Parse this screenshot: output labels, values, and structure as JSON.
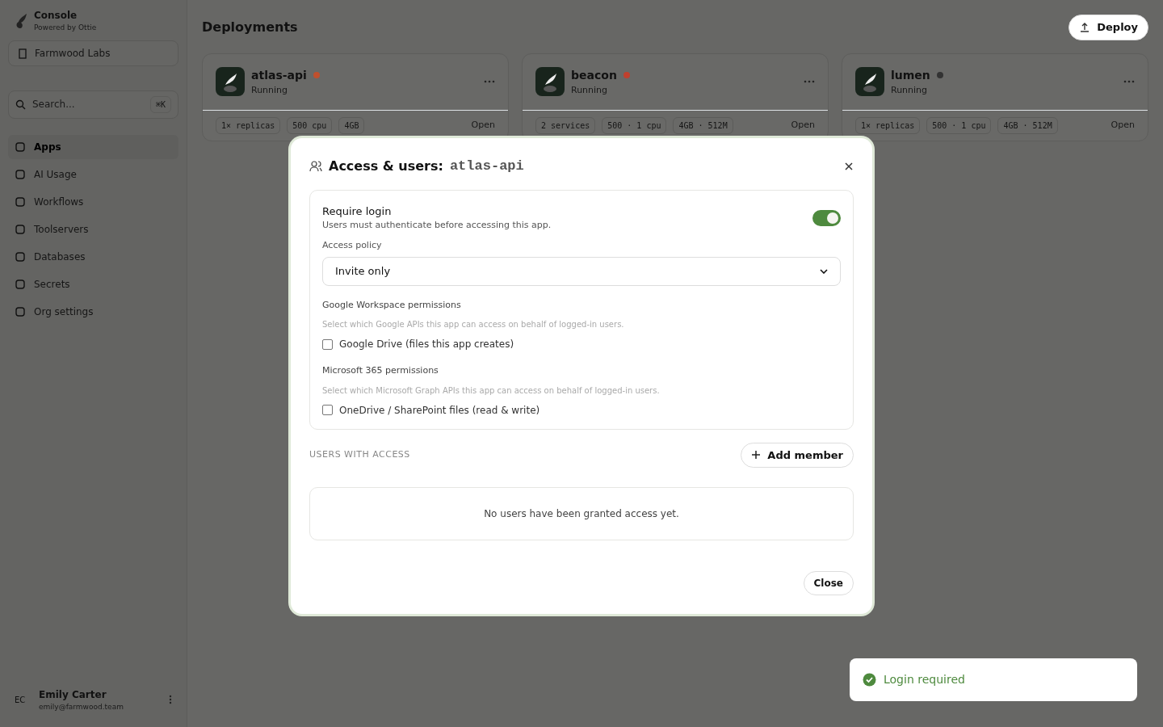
{
  "sidebar": {
    "brand": "Console",
    "brand_sub": "Powered by Ottie",
    "org": "Farmwood Labs",
    "search": {
      "placeholder": "Search...",
      "shortcut": "⌘K"
    },
    "items": [
      {
        "label": "Apps",
        "selected": true
      },
      {
        "label": "AI Usage",
        "selected": false
      },
      {
        "label": "Workflows",
        "selected": false
      },
      {
        "label": "Toolservers",
        "selected": false
      },
      {
        "label": "Databases",
        "selected": false
      },
      {
        "label": "Secrets",
        "selected": false
      },
      {
        "label": "Org settings",
        "selected": false
      }
    ],
    "user": {
      "initials": "EC",
      "name": "Emily Carter",
      "email": "emily@farmwood.team"
    }
  },
  "header": {
    "title": "Deployments",
    "deploy_button": "Deploy"
  },
  "apps": [
    {
      "name": "atlas-api",
      "status": "Running",
      "color": "#c0502e",
      "chips": [
        "1× replicas",
        "500 cpu",
        "4GB"
      ],
      "open": "Open"
    },
    {
      "name": "beacon",
      "status": "Running",
      "color": "#c0402e",
      "chips": [
        "2 services",
        "500 · 1 cpu",
        "4GB · 512M"
      ],
      "open": "Open"
    },
    {
      "name": "lumen",
      "status": "Running",
      "color": "#333333",
      "chips": [
        "1× replicas",
        "500 · 1 cpu",
        "4GB · 512M"
      ],
      "open": "Open"
    }
  ],
  "modal": {
    "title": "Access & users:",
    "app": "atlas-api",
    "require_login": {
      "label": "Require login",
      "description": "Users must authenticate before accessing this app.",
      "on": true
    },
    "access_policy": {
      "label": "Access policy",
      "value": "Invite only"
    },
    "permission_groups": [
      {
        "title": "Google Workspace permissions",
        "description": "Select which Google APIs this app can access on behalf of logged-in users.",
        "options": [
          {
            "label": "Google Drive (files this app creates)",
            "checked": false
          }
        ]
      },
      {
        "title": "Microsoft 365 permissions",
        "description": "Select which Microsoft Graph APIs this app can access on behalf of logged-in users.",
        "options": [
          {
            "label": "OneDrive / SharePoint files (read & write)",
            "checked": false
          }
        ]
      }
    ],
    "users_heading": "USERS WITH ACCESS",
    "add_member": "Add member",
    "empty_text": "No users have been granted access yet.",
    "close_button": "Close"
  },
  "toast": {
    "text": "Login required"
  }
}
